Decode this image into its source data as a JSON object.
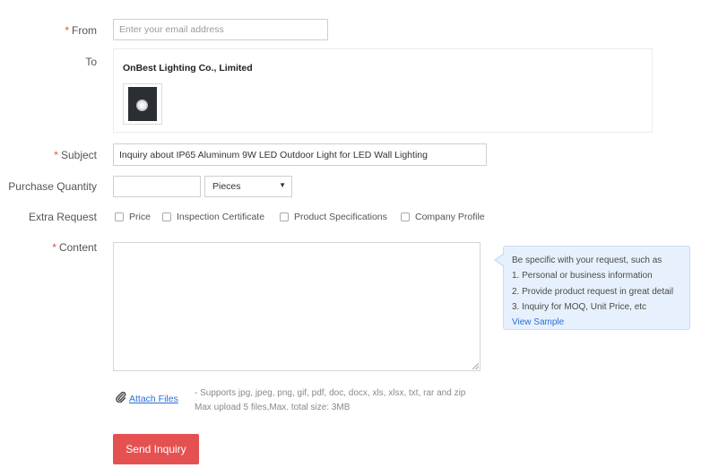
{
  "form": {
    "from": {
      "label": "From",
      "placeholder": "Enter your email address",
      "value": ""
    },
    "to": {
      "label": "To",
      "company": "OnBest Lighting Co., Limited",
      "image_icon": "product-thumbnail"
    },
    "subject": {
      "label": "Subject",
      "value": "Inquiry about IP65 Aluminum 9W LED Outdoor Light for LED Wall Lighting"
    },
    "quantity": {
      "label": "Purchase Quantity",
      "value": "",
      "unit": "Pieces",
      "unit_arrow": "▼"
    },
    "extra_request": {
      "label": "Extra Request",
      "options": [
        "Price",
        "Inspection Certificate",
        "Product Specifications",
        "Company Profile"
      ]
    },
    "content": {
      "label": "Content",
      "value": ""
    },
    "tooltip": {
      "intro": "Be specific with your request, such as",
      "items": [
        "1. Personal or business information",
        "2. Provide product request in great detail",
        "3. Inquiry for MOQ, Unit Price, etc"
      ],
      "link": "View Sample"
    },
    "attach": {
      "label": "Attach Files",
      "icon": "paperclip-icon",
      "supports": "- Supports jpg, jpeg, png, gif, pdf, doc, docx, xls, xlsx, txt, rar and zip",
      "max": "Max upload 5 files,Max. total size: 3MB"
    },
    "submit_label": "Send Inquiry",
    "required_mark": "*"
  },
  "colors": {
    "required": "#e0523b",
    "link": "#2c6ed6",
    "submit_bg": "#e55151",
    "tooltip_bg": "#e7f1fd"
  }
}
